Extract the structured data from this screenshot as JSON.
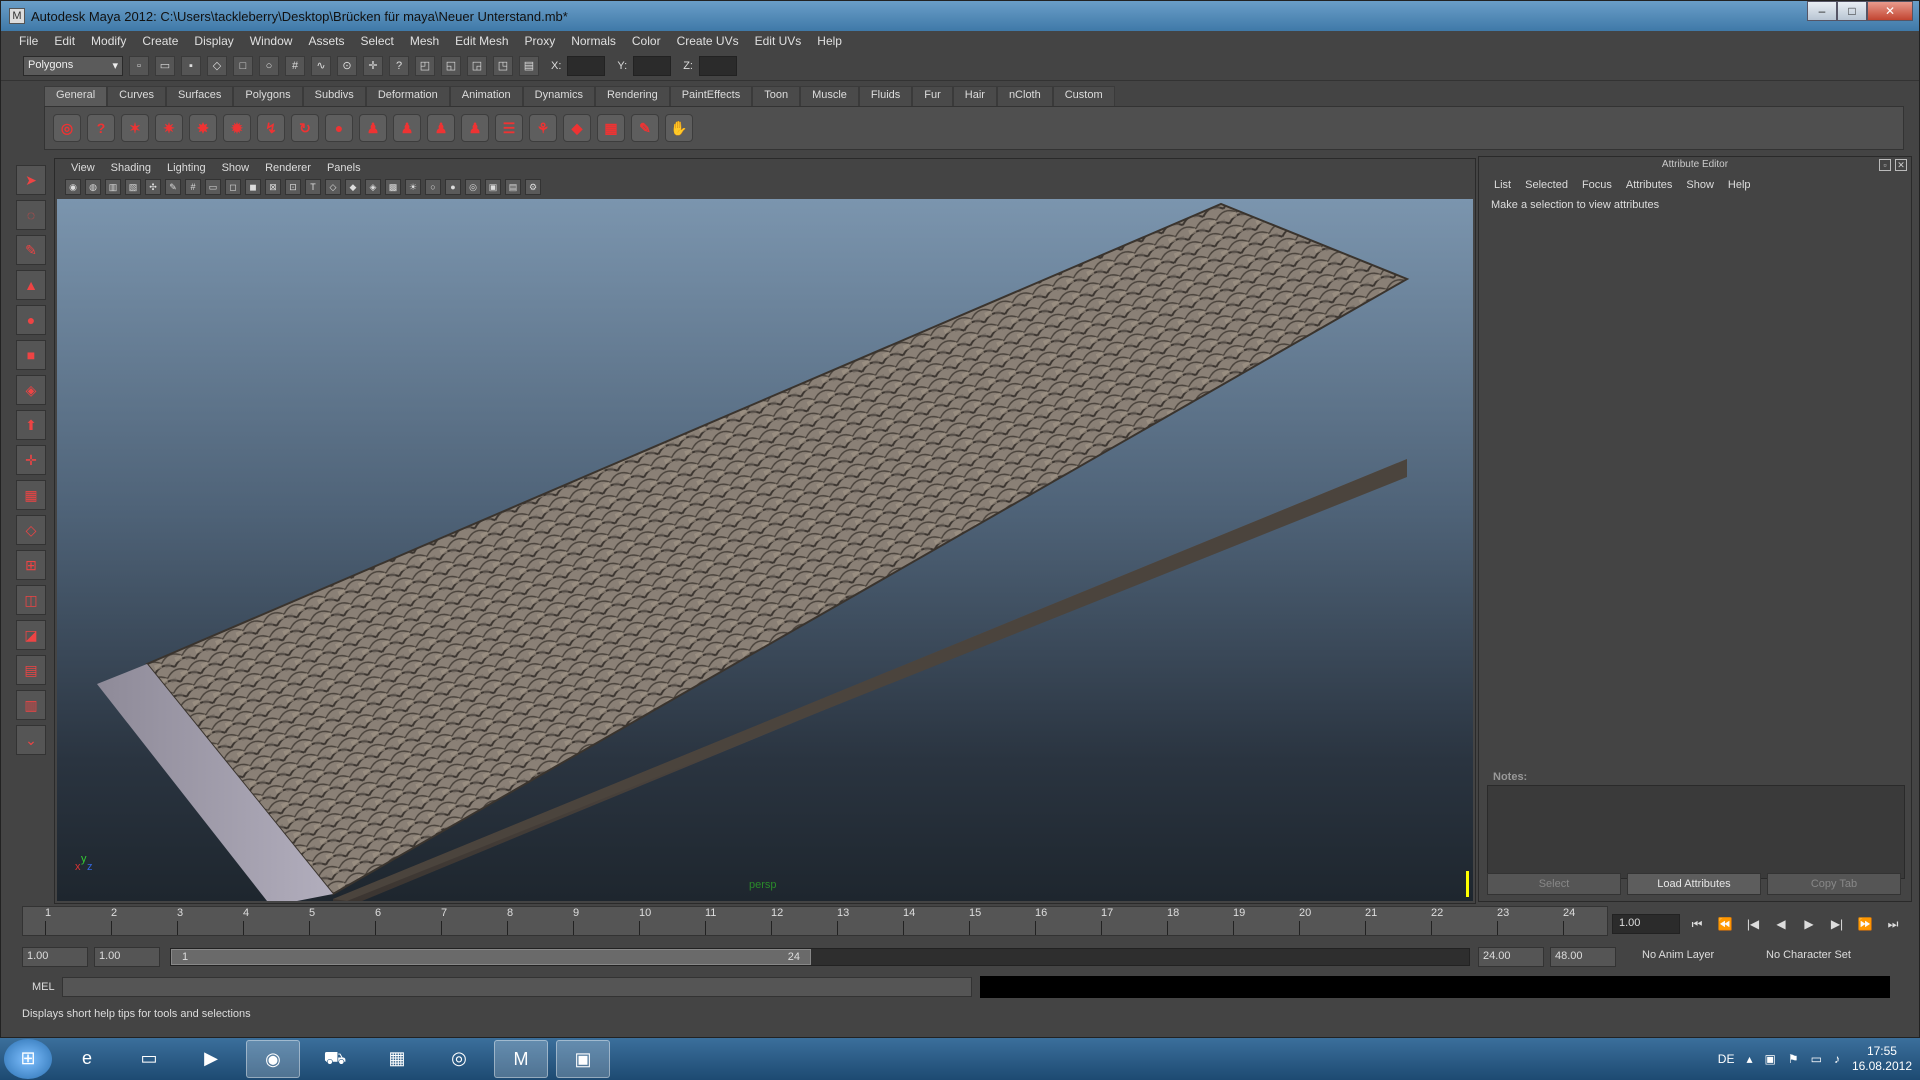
{
  "window": {
    "title": "Autodesk Maya 2012: C:\\Users\\tackleberry\\Desktop\\Brücken für maya\\Neuer Unterstand.mb*"
  },
  "menubar": [
    "File",
    "Edit",
    "Modify",
    "Create",
    "Display",
    "Window",
    "Assets",
    "Select",
    "Mesh",
    "Edit Mesh",
    "Proxy",
    "Normals",
    "Color",
    "Create UVs",
    "Edit UVs",
    "Help"
  ],
  "statusline": {
    "mode": "Polygons",
    "x_label": "X:",
    "y_label": "Y:",
    "z_label": "Z:"
  },
  "shelf_tabs": [
    "General",
    "Curves",
    "Surfaces",
    "Polygons",
    "Subdivs",
    "Deformation",
    "Animation",
    "Dynamics",
    "Rendering",
    "PaintEffects",
    "Toon",
    "Muscle",
    "Fluids",
    "Fur",
    "Hair",
    "nCloth",
    "Custom"
  ],
  "viewport": {
    "menu": [
      "View",
      "Shading",
      "Lighting",
      "Show",
      "Renderer",
      "Panels"
    ],
    "camera": "persp",
    "axis": {
      "x": "x",
      "y": "y",
      "z": "z"
    }
  },
  "attribute_editor": {
    "title": "Attribute Editor",
    "menu": [
      "List",
      "Selected",
      "Focus",
      "Attributes",
      "Show",
      "Help"
    ],
    "message": "Make a selection to view attributes",
    "notes_label": "Notes:",
    "buttons": {
      "select": "Select",
      "load": "Load Attributes",
      "copy": "Copy Tab"
    }
  },
  "timeslider": {
    "ticks": [
      "1",
      "2",
      "3",
      "4",
      "5",
      "6",
      "7",
      "8",
      "9",
      "10",
      "11",
      "12",
      "13",
      "14",
      "15",
      "16",
      "17",
      "18",
      "19",
      "20",
      "21",
      "22",
      "23",
      "24"
    ],
    "current_time": "1.00"
  },
  "range": {
    "start_time": "1.00",
    "playback_start": "1.00",
    "handle_start": "1",
    "handle_end": "24",
    "playback_end": "24.00",
    "end_time": "48.00",
    "anim_layer": "No Anim Layer",
    "character_set": "No Character Set"
  },
  "cmdline": {
    "label": "MEL"
  },
  "helpline": "Displays short help tips for tools and selections",
  "taskbar": {
    "language": "DE",
    "time": "17:55",
    "date": "16.08.2012"
  },
  "colors": {
    "accent": "#3f79a8",
    "panel": "#444444",
    "viewport_top": "#7b95ae",
    "viewport_bottom": "#1e262e"
  }
}
